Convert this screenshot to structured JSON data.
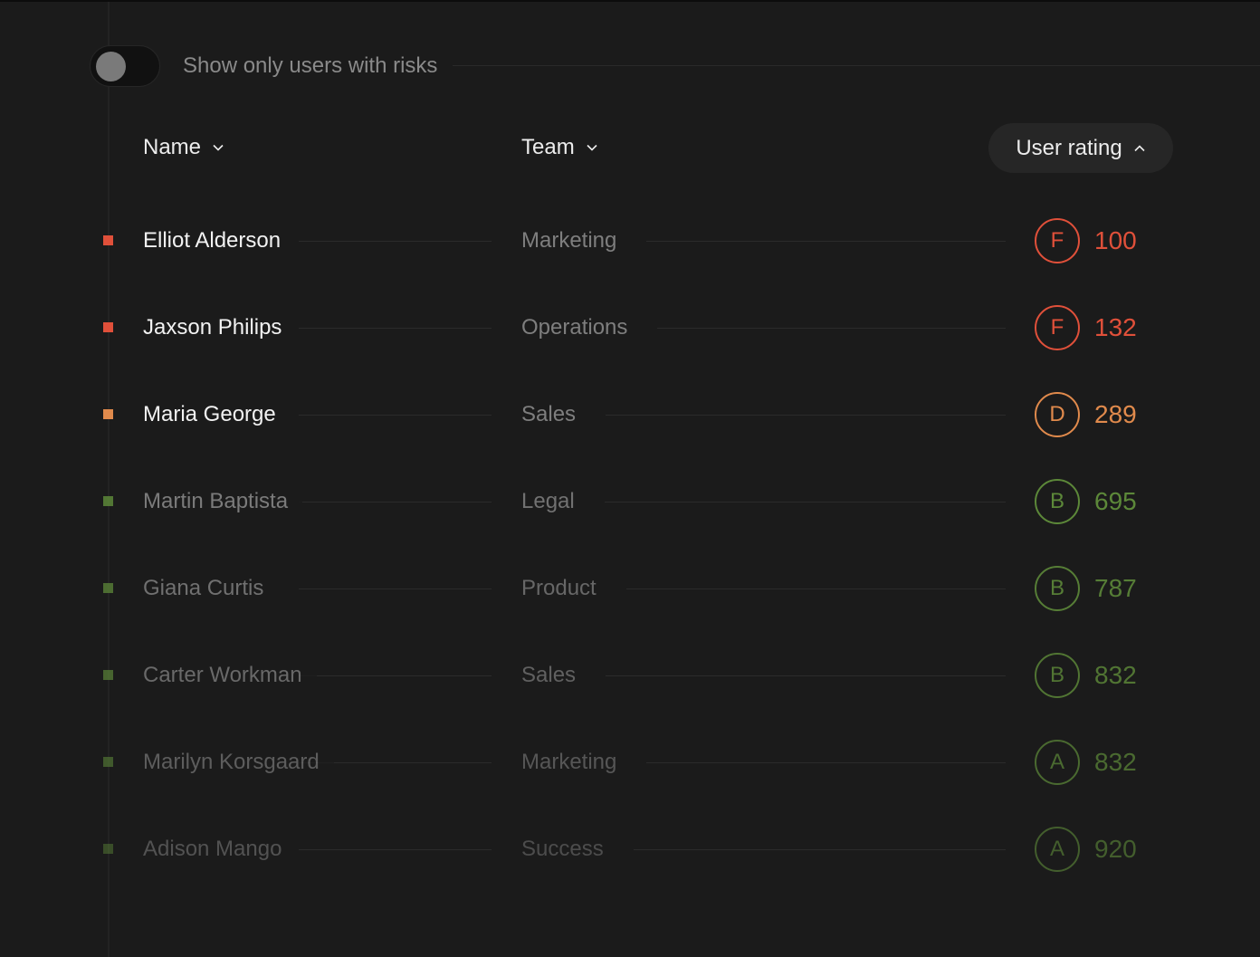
{
  "filter": {
    "label": "Show only users with risks",
    "enabled": false
  },
  "columns": {
    "name": "Name",
    "team": "Team",
    "rating": "User rating"
  },
  "colors": {
    "risk": "#e0503a",
    "warning": "#e08a4c",
    "good": "#5f8c3a"
  },
  "icons": {
    "name_sort": "chevron-down-icon",
    "team_sort": "chevron-down-icon",
    "rating_sort": "chevron-up-icon"
  },
  "users": [
    {
      "name": "Elliot Alderson",
      "team": "Marketing",
      "grade": "F",
      "score": "100",
      "status": "risk"
    },
    {
      "name": "Jaxson Philips",
      "team": "Operations",
      "grade": "F",
      "score": "132",
      "status": "risk"
    },
    {
      "name": "Maria George",
      "team": "Sales",
      "grade": "D",
      "score": "289",
      "status": "warning"
    },
    {
      "name": "Martin Baptista",
      "team": "Legal",
      "grade": "B",
      "score": "695",
      "status": "good"
    },
    {
      "name": "Giana Curtis",
      "team": "Product",
      "grade": "B",
      "score": "787",
      "status": "good"
    },
    {
      "name": "Carter Workman",
      "team": "Sales",
      "grade": "B",
      "score": "832",
      "status": "good"
    },
    {
      "name": "Marilyn Korsgaard",
      "team": "Marketing",
      "grade": "A",
      "score": "832",
      "status": "good"
    },
    {
      "name": "Adison Mango",
      "team": "Success",
      "grade": "A",
      "score": "920",
      "status": "good"
    }
  ]
}
